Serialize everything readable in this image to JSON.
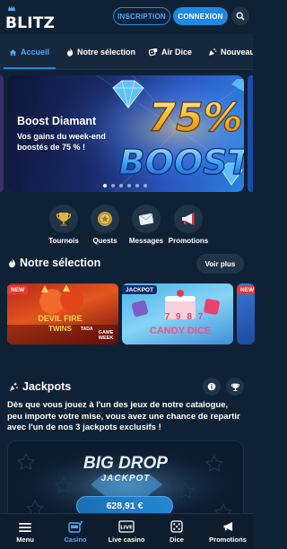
{
  "header": {
    "logo_text": "BLITZ",
    "signup_label": "INSCRIPTION",
    "login_label": "CONNEXION",
    "search_icon": "search-icon"
  },
  "tabs": [
    {
      "label": "Accueil",
      "icon": "home-icon",
      "active": true
    },
    {
      "label": "Notre sélection",
      "icon": "flame-icon"
    },
    {
      "label": "Air Dice",
      "icon": "dice-icon"
    },
    {
      "label": "Nouveau",
      "icon": "new-icon"
    }
  ],
  "banner": {
    "title": "Boost Diamant",
    "subtitle": "Vos gains du week-end boostés de 75 % !",
    "art_percent": "75%",
    "art_word": "BOOST",
    "slide_count": 6,
    "active_slide": 1
  },
  "quick_links": [
    {
      "label": "Tournois",
      "icon": "trophy-icon"
    },
    {
      "label": "Quests",
      "icon": "medal-icon"
    },
    {
      "label": "Messages",
      "icon": "envelope-icon"
    },
    {
      "label": "Promotions",
      "icon": "megaphone-icon"
    }
  ],
  "selection": {
    "title": "Notre sélection",
    "see_more": "Voir plus",
    "games": [
      {
        "badge": "NEW",
        "name_line1": "DEVIL FIRE",
        "name_line2": "TWINS",
        "tag": "GAME WEEK",
        "provider": "TADA"
      },
      {
        "badge": "JACKPOT",
        "name": "CANDY DICE",
        "extra": "7 9 8 7"
      },
      {
        "badge": "NEW"
      }
    ]
  },
  "jackpots": {
    "title": "Jackpots",
    "description": "Dès que vous jouez à l'un des jeux de notre catalogue, peu importe votre mise, vous avez une chance de repartir avec l'un de nos 3 jackpots exclusifs !",
    "card_title_1": "BIG DROP",
    "card_title_2": "JACKPOT",
    "amount": "628,91 €"
  },
  "bottom_nav": [
    {
      "label": "Menu",
      "icon": "menu-icon"
    },
    {
      "label": "Casino",
      "icon": "casino-icon",
      "active": true
    },
    {
      "label": "Live casino",
      "icon": "live-icon"
    },
    {
      "label": "Dice",
      "icon": "dice-icon"
    },
    {
      "label": "Promotions",
      "icon": "megaphone-icon"
    }
  ],
  "colors": {
    "background": "#0f2235",
    "accent": "#1e88e5",
    "surface": "#203447"
  }
}
